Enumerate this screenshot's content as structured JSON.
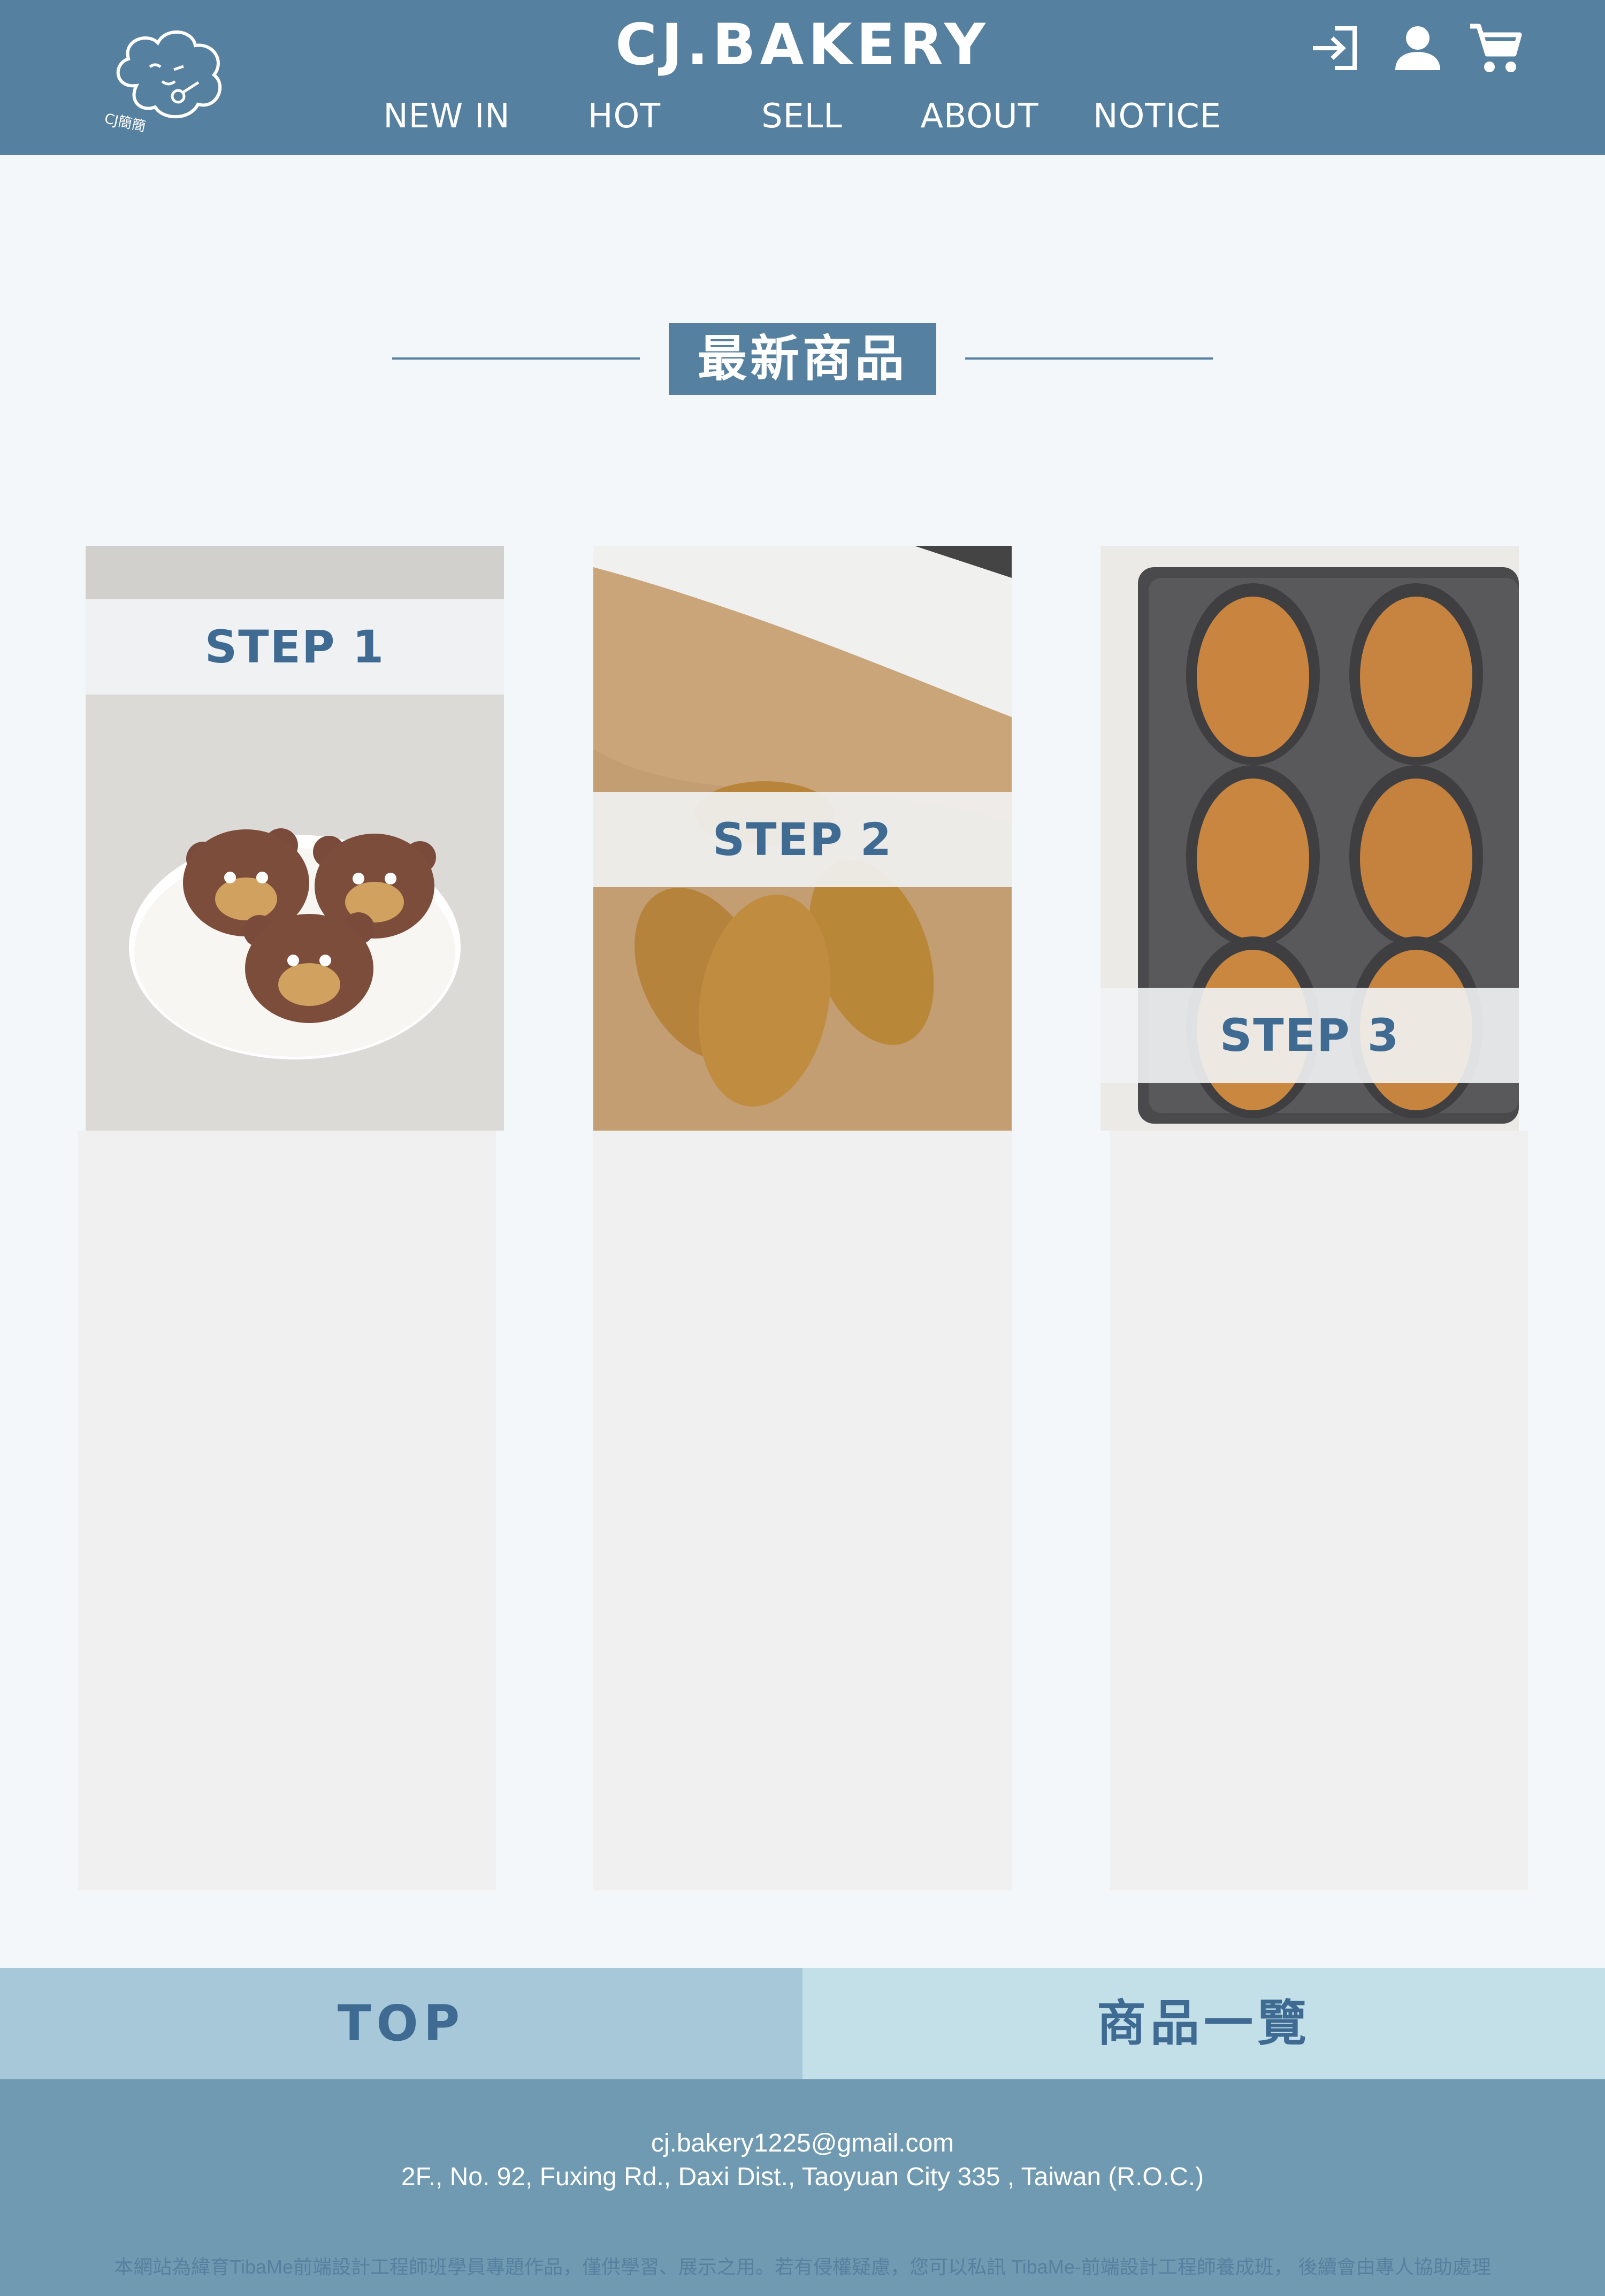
{
  "header": {
    "brand": "CJ.BAKERY",
    "logo_text": "CJ簡簡",
    "nav": [
      "NEW IN",
      "HOT",
      "SELL",
      "ABOUT",
      "NOTICE"
    ],
    "icons": [
      "login-icon",
      "user-icon",
      "cart-icon"
    ]
  },
  "section": {
    "title": "最新商品"
  },
  "steps": [
    {
      "label": "STEP 1"
    },
    {
      "label": "STEP 2"
    },
    {
      "label": "STEP 3"
    }
  ],
  "buttons": {
    "top": "TOP",
    "product_list": "商品一覽"
  },
  "footer": {
    "email": "cj.bakery1225@gmail.com",
    "address": "2F., No. 92, Fuxing Rd., Daxi Dist., Taoyuan City 335 , Taiwan (R.O.C.)",
    "note": "本網站為緯育TibaMe前端設計工程師班學員專題作品，僅供學習、展示之用。若有侵權疑慮，您可以私訊 TibaMe-前端設計工程師養成班， 後續會由專人協助處理"
  },
  "colors": {
    "header_bg": "#56809f",
    "page_bg": "#f3f7f9",
    "accent_text": "#3f6b93",
    "top_button_bg": "#a7c8d8",
    "list_button_bg": "#c3e0e9",
    "footer_bg": "#6f9ab2",
    "card_body_bg": "#f1f0f1"
  }
}
